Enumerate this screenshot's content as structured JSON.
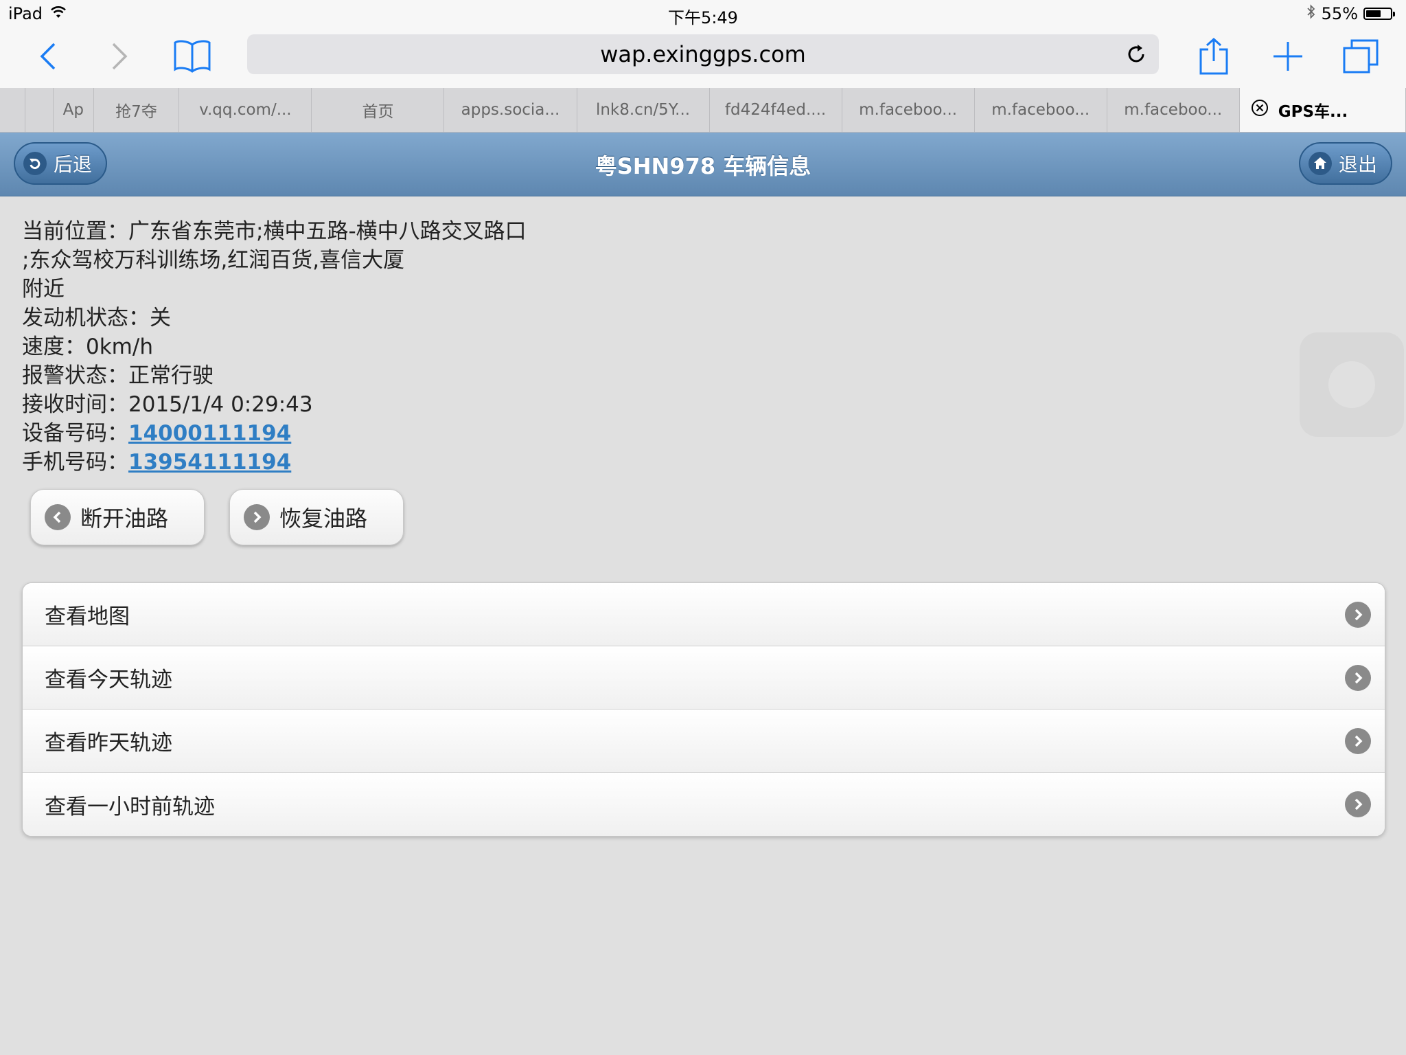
{
  "status_bar": {
    "device": "iPad",
    "time": "下午5:49",
    "battery": "55%",
    "battery_level": 0.55
  },
  "browser": {
    "url": "wap.exinggps.com",
    "tabs": [
      {
        "label": "Ap"
      },
      {
        "label": "抢7夺"
      },
      {
        "label": "v.qq.com/..."
      },
      {
        "label": "首页"
      },
      {
        "label": "apps.socia..."
      },
      {
        "label": "lnk8.cn/5Y..."
      },
      {
        "label": "fd424f4ed...."
      },
      {
        "label": "m.faceboo..."
      },
      {
        "label": "m.faceboo..."
      },
      {
        "label": "m.faceboo..."
      },
      {
        "label": "GPS车..."
      }
    ]
  },
  "header": {
    "back_label": "后退",
    "title": "粤SHN978 车辆信息",
    "logout_label": "退出"
  },
  "vehicle": {
    "location_label": "当前位置：",
    "location_line1": "广东省东莞市;横中五路-横中八路交叉路口",
    "location_line2": ";东众驾校万科训练场,红润百货,喜信大厦",
    "location_line3": "附近",
    "engine_label": "发动机状态：",
    "engine_value": "关",
    "speed_label": "速度：",
    "speed_value": "0km/h",
    "alarm_label": "报警状态：",
    "alarm_value": "正常行驶",
    "time_label": "接收时间：",
    "time_value": "2015/1/4 0:29:43",
    "device_label": "设备号码：",
    "device_value": "14000111194",
    "phone_label": "手机号码：",
    "phone_value": "13954111194"
  },
  "actions": {
    "cut_oil": "断开油路",
    "restore_oil": "恢复油路"
  },
  "menu": [
    {
      "label": "查看地图"
    },
    {
      "label": "查看今天轨迹"
    },
    {
      "label": "查看昨天轨迹"
    },
    {
      "label": "查看一小时前轨迹"
    }
  ],
  "colors": {
    "header_top": "#81a8ce",
    "header_bottom": "#5e87b0",
    "link": "#2f7ec4",
    "ios_blue": "#1a7cf4"
  }
}
